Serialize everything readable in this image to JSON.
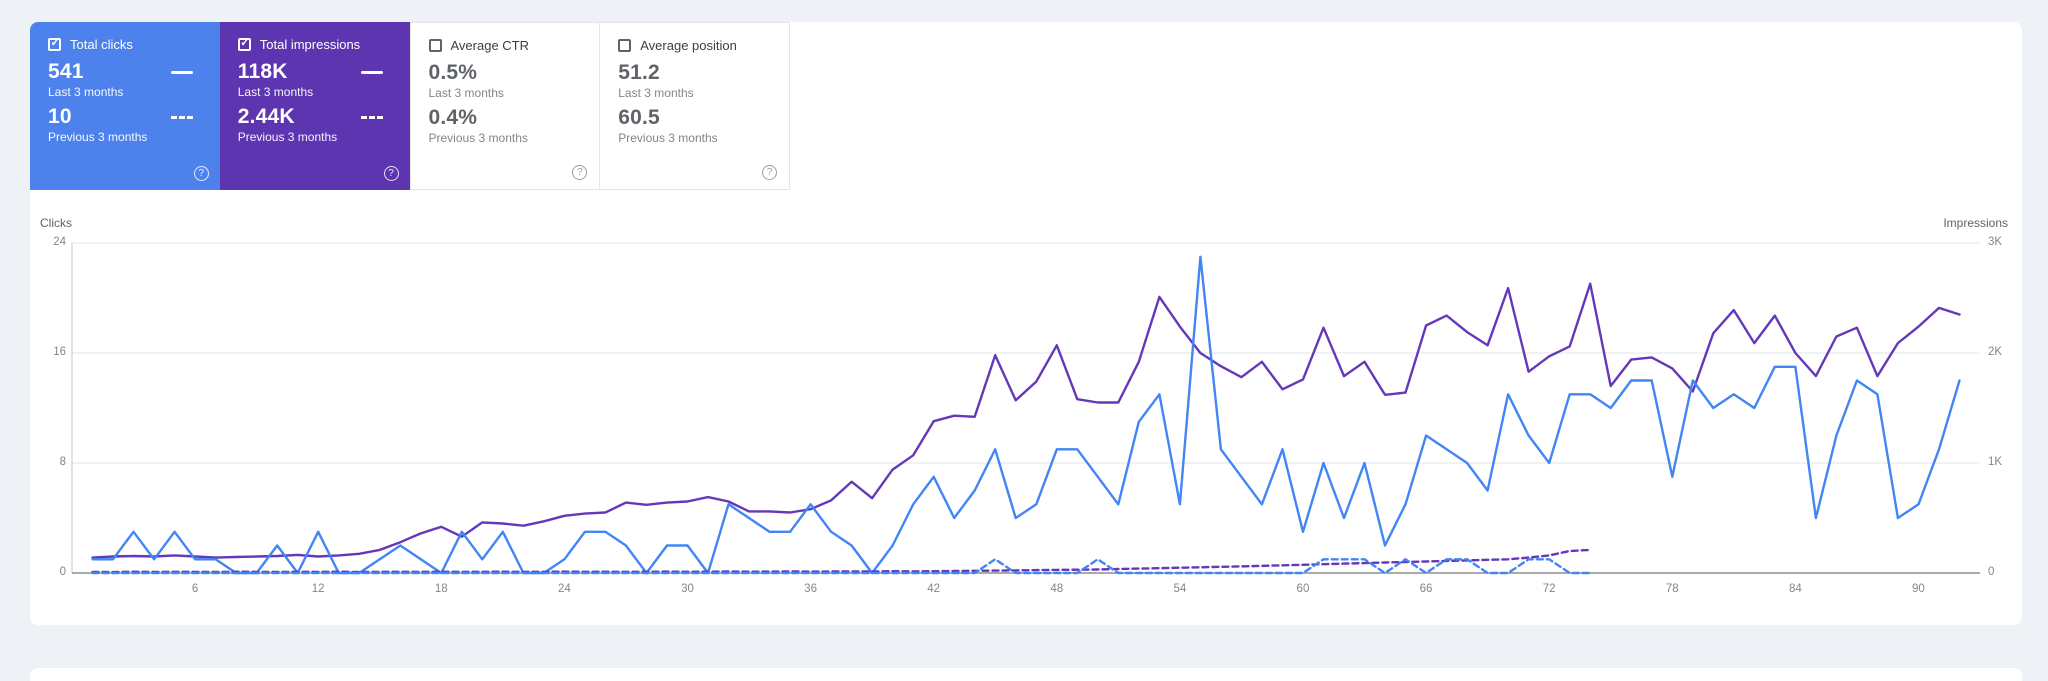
{
  "page": {
    "background": "#eef1f6",
    "card_background": "#ffffff"
  },
  "tiles": {
    "items": [
      {
        "label": "Total clicks",
        "selected": true,
        "bg": "#4d82ec",
        "value_last": "541",
        "period_last": "Last 3 months",
        "value_prev": "10",
        "period_prev": "Previous 3 months",
        "help_icon": "?"
      },
      {
        "label": "Total impressions",
        "selected": true,
        "bg": "#5e35b1",
        "value_last": "118K",
        "period_last": "Last 3 months",
        "value_prev": "2.44K",
        "period_prev": "Previous 3 months",
        "help_icon": "?"
      },
      {
        "label": "Average CTR",
        "selected": false,
        "bg": "#ffffff",
        "value_last": "0.5%",
        "period_last": "Last 3 months",
        "value_prev": "0.4%",
        "period_prev": "Previous 3 months",
        "help_icon": "?"
      },
      {
        "label": "Average position",
        "selected": false,
        "bg": "#ffffff",
        "value_last": "51.2",
        "period_last": "Last 3 months",
        "value_prev": "60.5",
        "period_prev": "Previous 3 months",
        "help_icon": "?"
      }
    ]
  },
  "chart_data": {
    "type": "line",
    "left_axis": {
      "title": "Clicks",
      "range": [
        0,
        24
      ],
      "ticks": [
        0,
        8,
        16,
        24
      ],
      "tick_labels": [
        "0",
        "8",
        "16",
        "24"
      ]
    },
    "right_axis": {
      "title": "Impressions",
      "range": [
        0,
        3000
      ],
      "ticks": [
        0,
        1000,
        2000,
        3000
      ],
      "tick_labels": [
        "0",
        "1K",
        "2K",
        "3K"
      ]
    },
    "x_axis": {
      "range": [
        0,
        93
      ],
      "ticks": [
        6,
        12,
        18,
        24,
        30,
        36,
        42,
        48,
        54,
        60,
        66,
        72,
        78,
        84,
        90
      ],
      "unit": "day-index"
    },
    "grid": true,
    "colors": {
      "clicks": "#4285f4",
      "impressions": "#6438b8"
    },
    "series": [
      {
        "name": "Impressions - Last 3 months",
        "axis": "right",
        "style": "solid",
        "color": "#6438b8",
        "values": [
          140,
          150,
          155,
          150,
          160,
          150,
          140,
          145,
          150,
          155,
          165,
          150,
          160,
          175,
          210,
          280,
          360,
          420,
          330,
          460,
          450,
          430,
          470,
          520,
          540,
          550,
          640,
          620,
          640,
          650,
          690,
          650,
          560,
          560,
          550,
          580,
          660,
          830,
          680,
          940,
          1070,
          1380,
          1430,
          1420,
          1980,
          1570,
          1740,
          2070,
          1580,
          1550,
          1550,
          1920,
          2510,
          2240,
          2000,
          1880,
          1780,
          1920,
          1670,
          1760,
          2230,
          1790,
          1920,
          1620,
          1640,
          2250,
          2340,
          2190,
          2070,
          2590,
          1830,
          1970,
          2060,
          2630,
          1700,
          1940,
          1960,
          1860,
          1650,
          2180,
          2390,
          2090,
          2340,
          2000,
          1790,
          2150,
          2230,
          1790,
          2090,
          2240,
          2410,
          2350
        ]
      },
      {
        "name": "Clicks - Last 3 months",
        "axis": "left",
        "style": "solid",
        "color": "#4285f4",
        "values": [
          1,
          1,
          3,
          1,
          3,
          1,
          1,
          0,
          0,
          2,
          0,
          3,
          0,
          0,
          1,
          2,
          1,
          0,
          3,
          1,
          3,
          0,
          0,
          1,
          3,
          3,
          2,
          0,
          2,
          2,
          0,
          5,
          4,
          3,
          3,
          5,
          3,
          2,
          0,
          2,
          5,
          7,
          4,
          6,
          9,
          4,
          5,
          9,
          9,
          7,
          5,
          11,
          13,
          5,
          23,
          9,
          7,
          5,
          9,
          3,
          8,
          4,
          8,
          2,
          5,
          10,
          9,
          8,
          6,
          13,
          10,
          8,
          13,
          13,
          12,
          14,
          14,
          7,
          14,
          12,
          13,
          12,
          15,
          15,
          4,
          10,
          14,
          13,
          4,
          5,
          9,
          14
        ]
      },
      {
        "name": "Impressions - Previous 3 months",
        "axis": "right",
        "style": "dashed",
        "color": "#6438b8",
        "values": [
          10,
          8,
          12,
          9,
          11,
          10,
          9,
          12,
          10,
          9,
          11,
          10,
          12,
          9,
          10,
          11,
          10,
          12,
          10,
          11,
          12,
          10,
          11,
          13,
          11,
          12,
          10,
          12,
          13,
          11,
          12,
          14,
          12,
          13,
          15,
          13,
          14,
          15,
          14,
          16,
          15,
          16,
          18,
          20,
          22,
          24,
          26,
          28,
          30,
          32,
          36,
          40,
          44,
          48,
          52,
          56,
          60,
          65,
          70,
          75,
          80,
          85,
          90,
          95,
          100,
          105,
          110,
          115,
          120,
          125,
          140,
          160,
          200,
          210
        ]
      },
      {
        "name": "Clicks - Previous 3 months",
        "axis": "left",
        "style": "dashed",
        "color": "#4285f4",
        "values": [
          0,
          0,
          0,
          0,
          0,
          0,
          0,
          0,
          0,
          0,
          0,
          0,
          0,
          0,
          0,
          0,
          0,
          0,
          0,
          0,
          0,
          0,
          0,
          0,
          0,
          0,
          0,
          0,
          0,
          0,
          0,
          0,
          0,
          0,
          0,
          0,
          0,
          0,
          0,
          0,
          0,
          0,
          0,
          0,
          1,
          0,
          0,
          0,
          0,
          1,
          0,
          0,
          0,
          0,
          0,
          0,
          0,
          0,
          0,
          0,
          1,
          1,
          1,
          0,
          1,
          0,
          1,
          1,
          0,
          0,
          1,
          1,
          0,
          0
        ]
      }
    ]
  }
}
